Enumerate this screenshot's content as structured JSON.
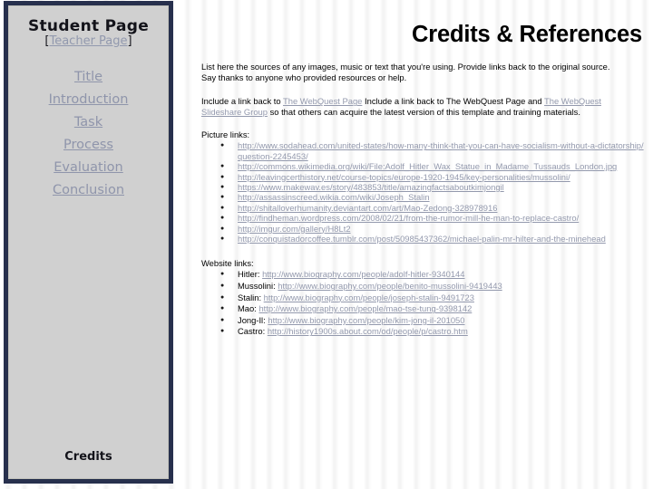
{
  "sidebar": {
    "student_page_title": "Student Page",
    "teacher_page_bracket_open": "[",
    "teacher_page_link": "Teacher Page",
    "teacher_page_bracket_close": "]",
    "nav_items": [
      {
        "label": "Title"
      },
      {
        "label": "Introduction"
      },
      {
        "label": "Task"
      },
      {
        "label": "Process"
      },
      {
        "label": "Evaluation"
      },
      {
        "label": "Conclusion"
      }
    ],
    "credits_label": "Credits"
  },
  "main": {
    "title": "Credits & References",
    "intro_paragraph": "List here the sources of any images, music or text that you're using. Provide links back to the original source. Say thanks to anyone who provided resources or help.",
    "webquest_paragraph": {
      "part1": "Include a link back to ",
      "link1": "The WebQuest Page",
      "part2": " Include a link back to The WebQuest Page and ",
      "link2": "The WebQuest Slideshare Group",
      "part3": " so that others can acquire the latest version of this template and training materials."
    },
    "picture_links_heading": "Picture links:",
    "picture_links": [
      "http://www.sodahead.com/united-states/how-many-think-that-you-can-have-socialism-without-a-dictatorship/question-2245453/",
      "http://commons.wikimedia.org/wiki/File:Adolf_Hitler_Wax_Statue_in_Madame_Tussauds_London.jpg",
      "http://leavingcerthistory.net/course-topics/europe-1920-1945/key-personalities/mussolini/",
      "https://www.makewav.es/story/483853/title/amazingfactsaboutkimjongil",
      "http://assassinscreed.wikia.com/wiki/Joseph_Stalin",
      "http://shitalloverhumanity.deviantart.com/art/Mao-Zedong-328978916",
      "http://findheman.wordpress.com/2008/02/21/from-the-rumor-mill-he-man-to-replace-castro/",
      "http://imgur.com/gallery/H8Lt2",
      "http://conquistadorcoffee.tumblr.com/post/50985437362/michael-palin-mr-hilter-and-the-minehead"
    ],
    "website_links_heading": "Website links:",
    "website_links": [
      {
        "person": "Hitler:",
        "url": "http://www.biography.com/people/adolf-hitler-9340144"
      },
      {
        "person": "Mussolini:",
        "url": "http://www.biography.com/people/benito-mussolini-9419443"
      },
      {
        "person": "Stalin:",
        "url": "http://www.biography.com/people/joseph-stalin-9491723"
      },
      {
        "person": "Mao:",
        "url": "http://www.biography.com/people/mao-tse-tung-9398142"
      },
      {
        "person": "Jong-Il:",
        "url": "http://www.biography.com/people/kim-jong-il-201050"
      },
      {
        "person": "Castro:",
        "url": "http://history1900s.about.com/od/people/p/castro.htm"
      }
    ]
  },
  "colors": {
    "sidebar_border": "#27304d",
    "sidebar_background": "#d0d0d0",
    "link": "#9399ad",
    "text": "#000000"
  }
}
